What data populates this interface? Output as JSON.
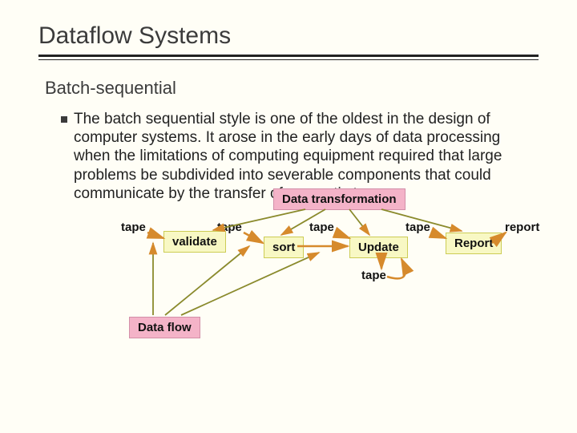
{
  "title": "Dataflow Systems",
  "subtitle": "Batch-sequential",
  "paragraph": "The batch sequential style is one of the oldest in the design of computer systems. It arose in the early days of data processing when the limitations of computing equipment required that large problems be subdivided into severable components that could communicate by the transfer of magnetic tapes.",
  "annot_transform": "Data transformation",
  "annot_flow": "Data flow",
  "labels": {
    "tape1": "tape",
    "tape2": "tape",
    "tape3": "tape",
    "tape4": "tape",
    "tape5": "tape",
    "report": "report"
  },
  "boxes": {
    "validate": "validate",
    "sort": "sort",
    "update": "Update",
    "report": "Report"
  }
}
